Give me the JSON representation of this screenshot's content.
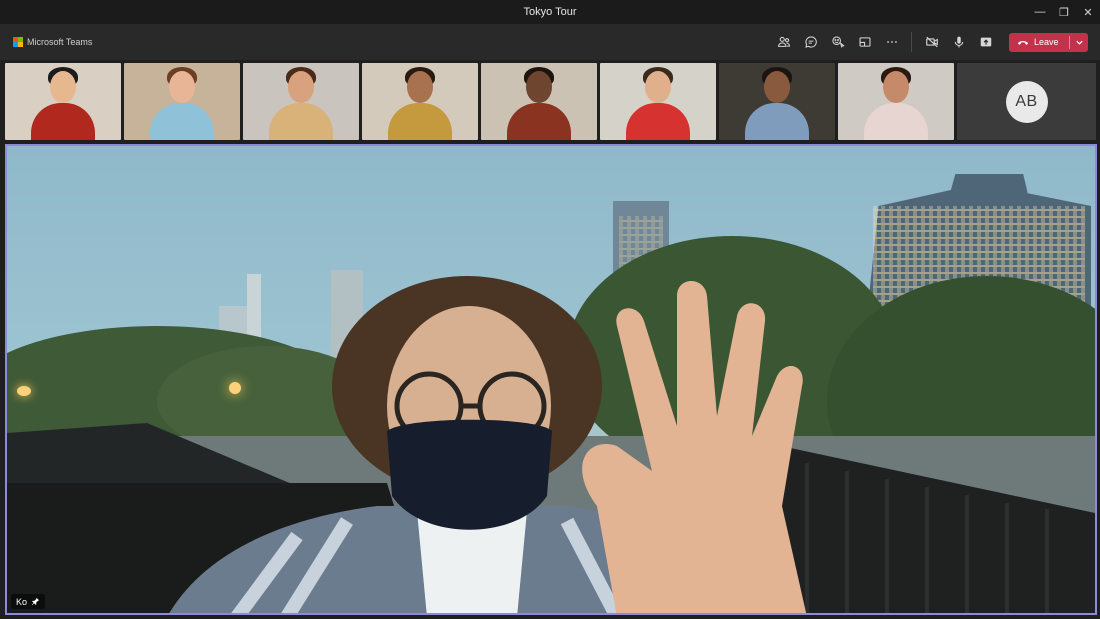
{
  "window": {
    "title": "Tokyo Tour",
    "minimize_glyph": "—",
    "maximize_glyph": "❐",
    "close_glyph": "✕"
  },
  "app": {
    "name": "Microsoft Teams",
    "logo_colors": [
      "#f25022",
      "#7fba00",
      "#00a4ef",
      "#ffb900"
    ]
  },
  "toolbar": {
    "icons": [
      "participants-icon",
      "chat-icon",
      "reactions-icon",
      "rooms-icon",
      "more-icon",
      "camera-off-icon",
      "microphone-icon",
      "share-icon"
    ],
    "leave_label": "Leave",
    "leave_color": "#c4314b"
  },
  "participants": [
    {
      "wall": "#d9cfc2",
      "skin": "#e6b890",
      "hair": "#1c1c1c",
      "shirt": "#b0281e"
    },
    {
      "wall": "#c7b39a",
      "skin": "#e8b697",
      "hair": "#6b3f26",
      "shirt": "#8fc2d8"
    },
    {
      "wall": "#c9c4be",
      "skin": "#d7a27d",
      "hair": "#4a2a18",
      "shirt": "#d8b278"
    },
    {
      "wall": "#d3cabb",
      "skin": "#a8714f",
      "hair": "#2a1b12",
      "shirt": "#c59a3e"
    },
    {
      "wall": "#cbc2b4",
      "skin": "#6e4630",
      "hair": "#1e140e",
      "shirt": "#8a3320"
    },
    {
      "wall": "#d5d2c9",
      "skin": "#e0b08c",
      "hair": "#3a2a1e",
      "shirt": "#d6322f"
    },
    {
      "wall": "#3e3a34",
      "skin": "#8a5a3e",
      "hair": "#1b1410",
      "shirt": "#7f9cbd"
    },
    {
      "wall": "#cfcac3",
      "skin": "#c58a6a",
      "hair": "#2a1a12",
      "shirt": "#e7d5d2"
    }
  ],
  "avatar": {
    "initials": "AB"
  },
  "stage": {
    "speaker_name": "Ko",
    "border_color": "#8b8bd8"
  }
}
